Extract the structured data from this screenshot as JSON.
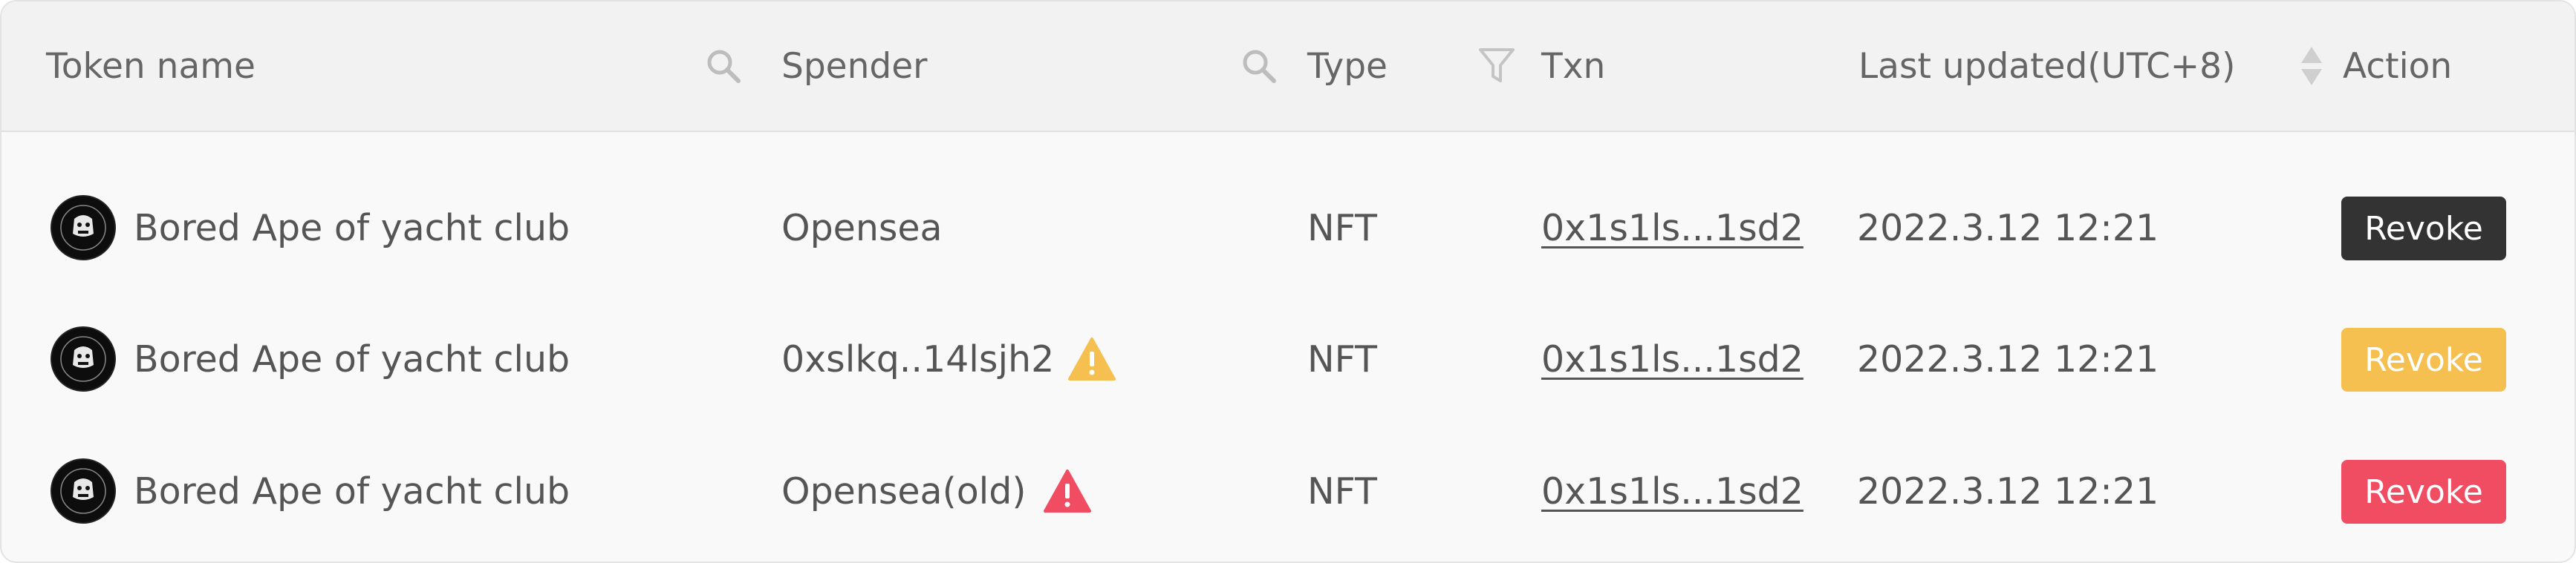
{
  "table": {
    "headers": {
      "token_name": "Token name",
      "spender": "Spender",
      "type": "Type",
      "txn": "Txn",
      "last_updated": "Last updated(UTC+8)",
      "action": "Action"
    },
    "rows": [
      {
        "token": "Bored Ape of yacht club",
        "spender": "Opensea",
        "spender_warning": "none",
        "type": "NFT",
        "txn": "0x1s1ls...1sd2",
        "updated": "2022.3.12 12:21",
        "action": "Revoke",
        "action_color": "#333333"
      },
      {
        "token": "Bored Ape of yacht club",
        "spender": "0xslkq..14lsjh2",
        "spender_warning": "caution",
        "type": "NFT",
        "txn": "0x1s1ls...1sd2",
        "updated": "2022.3.12 12:21",
        "action": "Revoke",
        "action_color": "#f5c04f"
      },
      {
        "token": "Bored Ape of yacht club",
        "spender": "Opensea(old)",
        "spender_warning": "danger",
        "type": "NFT",
        "txn": "0x1s1ls...1sd2",
        "updated": "2022.3.12 12:21",
        "action": "Revoke",
        "action_color": "#f04d63"
      }
    ]
  },
  "icons": {
    "token_search": "search-icon",
    "spender_search": "search-icon",
    "type_filter": "filter-icon",
    "sort": "sort-icon",
    "avatar": "bored-ape-logo",
    "caution": "warning-triangle-icon",
    "danger": "alert-triangle-icon"
  },
  "colors": {
    "caution": "#f5c04f",
    "danger": "#f04d63"
  }
}
